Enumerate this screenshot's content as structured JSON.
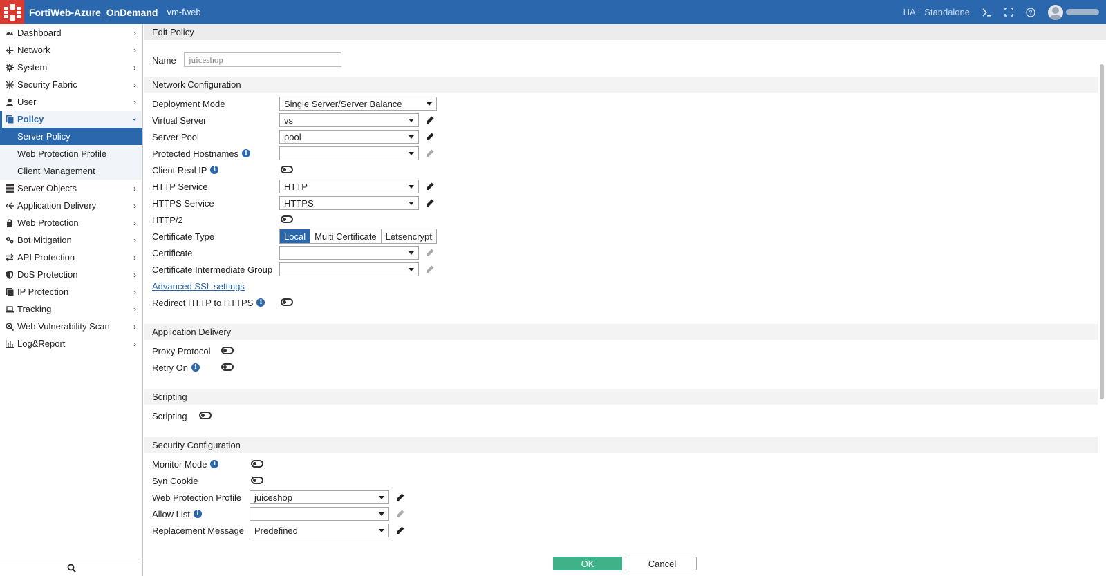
{
  "header": {
    "app_title": "FortiWeb-Azure_OnDemand",
    "host_name": "vm-fweb",
    "ha_label": "HA :",
    "ha_value": "Standalone",
    "brand_color": "#2b67ad",
    "logo_color": "#d93a32"
  },
  "sidebar": {
    "items": [
      {
        "label": "Dashboard",
        "icon": "dashboard-icon"
      },
      {
        "label": "Network",
        "icon": "network-icon"
      },
      {
        "label": "System",
        "icon": "gear-icon"
      },
      {
        "label": "Security Fabric",
        "icon": "fabric-icon"
      },
      {
        "label": "User",
        "icon": "user-icon"
      },
      {
        "label": "Policy",
        "icon": "policy-icon"
      },
      {
        "label": "Server Objects",
        "icon": "server-icon"
      },
      {
        "label": "Application Delivery",
        "icon": "delivery-icon"
      },
      {
        "label": "Web Protection",
        "icon": "lock-icon"
      },
      {
        "label": "Bot Mitigation",
        "icon": "bot-icon"
      },
      {
        "label": "API Protection",
        "icon": "api-icon"
      },
      {
        "label": "DoS Protection",
        "icon": "shield-icon"
      },
      {
        "label": "IP Protection",
        "icon": "ip-icon"
      },
      {
        "label": "Tracking",
        "icon": "laptop-icon"
      },
      {
        "label": "Web Vulnerability Scan",
        "icon": "scan-icon"
      },
      {
        "label": "Log&Report",
        "icon": "chart-icon"
      }
    ],
    "policy_sub": [
      {
        "label": "Server Policy"
      },
      {
        "label": "Web Protection Profile"
      },
      {
        "label": "Client Management"
      }
    ]
  },
  "page": {
    "title": "Edit Policy",
    "name_label": "Name",
    "name_value": "juiceshop"
  },
  "network": {
    "heading": "Network Configuration",
    "deployment_mode_label": "Deployment Mode",
    "deployment_mode_value": "Single Server/Server Balance",
    "virtual_server_label": "Virtual Server",
    "virtual_server_value": "vs",
    "server_pool_label": "Server Pool",
    "server_pool_value": "pool",
    "protected_hostnames_label": "Protected Hostnames",
    "protected_hostnames_value": "",
    "client_real_ip_label": "Client Real IP",
    "http_service_label": "HTTP Service",
    "http_service_value": "HTTP",
    "https_service_label": "HTTPS Service",
    "https_service_value": "HTTPS",
    "http2_label": "HTTP/2",
    "cert_type_label": "Certificate Type",
    "cert_type_options": [
      "Local",
      "Multi Certificate",
      "Letsencrypt"
    ],
    "cert_type_selected": "Local",
    "certificate_label": "Certificate",
    "certificate_value": "",
    "cert_intermediate_label": "Certificate Intermediate Group",
    "cert_intermediate_value": "",
    "advanced_ssl_link": "Advanced SSL settings",
    "redirect_label": "Redirect HTTP to HTTPS"
  },
  "delivery": {
    "heading": "Application Delivery",
    "proxy_protocol_label": "Proxy Protocol",
    "retry_on_label": "Retry On"
  },
  "scripting": {
    "heading": "Scripting",
    "scripting_label": "Scripting"
  },
  "security": {
    "heading": "Security Configuration",
    "monitor_mode_label": "Monitor Mode",
    "syn_cookie_label": "Syn Cookie",
    "wpp_label": "Web Protection Profile",
    "wpp_value": "juiceshop",
    "allow_list_label": "Allow List",
    "allow_list_value": "",
    "replacement_label": "Replacement Message",
    "replacement_value": "Predefined"
  },
  "footer": {
    "ok_label": "OK",
    "cancel_label": "Cancel",
    "ok_color": "#3fb28a"
  }
}
